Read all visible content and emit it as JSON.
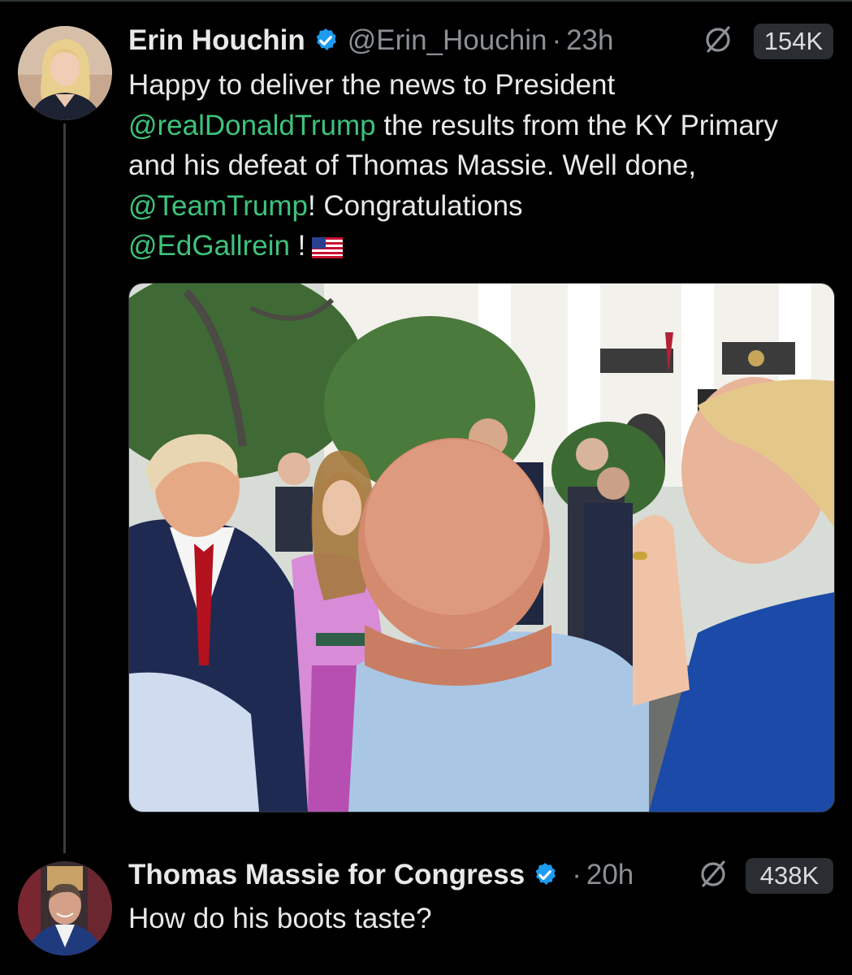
{
  "tweets": [
    {
      "author": "Erin Houchin",
      "handle": "@Erin_Houchin",
      "separator": "·",
      "time": "23h",
      "views": "154K",
      "text": {
        "line1": "Happy to deliver the news to President",
        "mention1": "@realDonaldTrump",
        "line2": " the results from the KY Primary and his defeat of Thomas Massie.  Well done, ",
        "mention2": "@TeamTrump",
        "line3": "! Congratulations ",
        "mention3": "@EdGallrein",
        "line4": " !"
      },
      "icons": {
        "avatar": "avatar-icon",
        "verified": "verified-badge-icon",
        "grok": "grok-icon",
        "flag": "us-flag-icon"
      }
    },
    {
      "author": "Thomas Massie for Congress",
      "separator": "·",
      "time": "20h",
      "views": "438K",
      "text": "How do his boots taste?",
      "icons": {
        "avatar": "avatar-icon",
        "verified": "verified-badge-icon",
        "grok": "grok-icon"
      }
    }
  ],
  "colors": {
    "background": "#000000",
    "text": "#e7e9ea",
    "secondary": "#8b9096",
    "mention": "#3ec27c",
    "verified": "#1d9bf0",
    "views_pill": "#2a2d31"
  }
}
